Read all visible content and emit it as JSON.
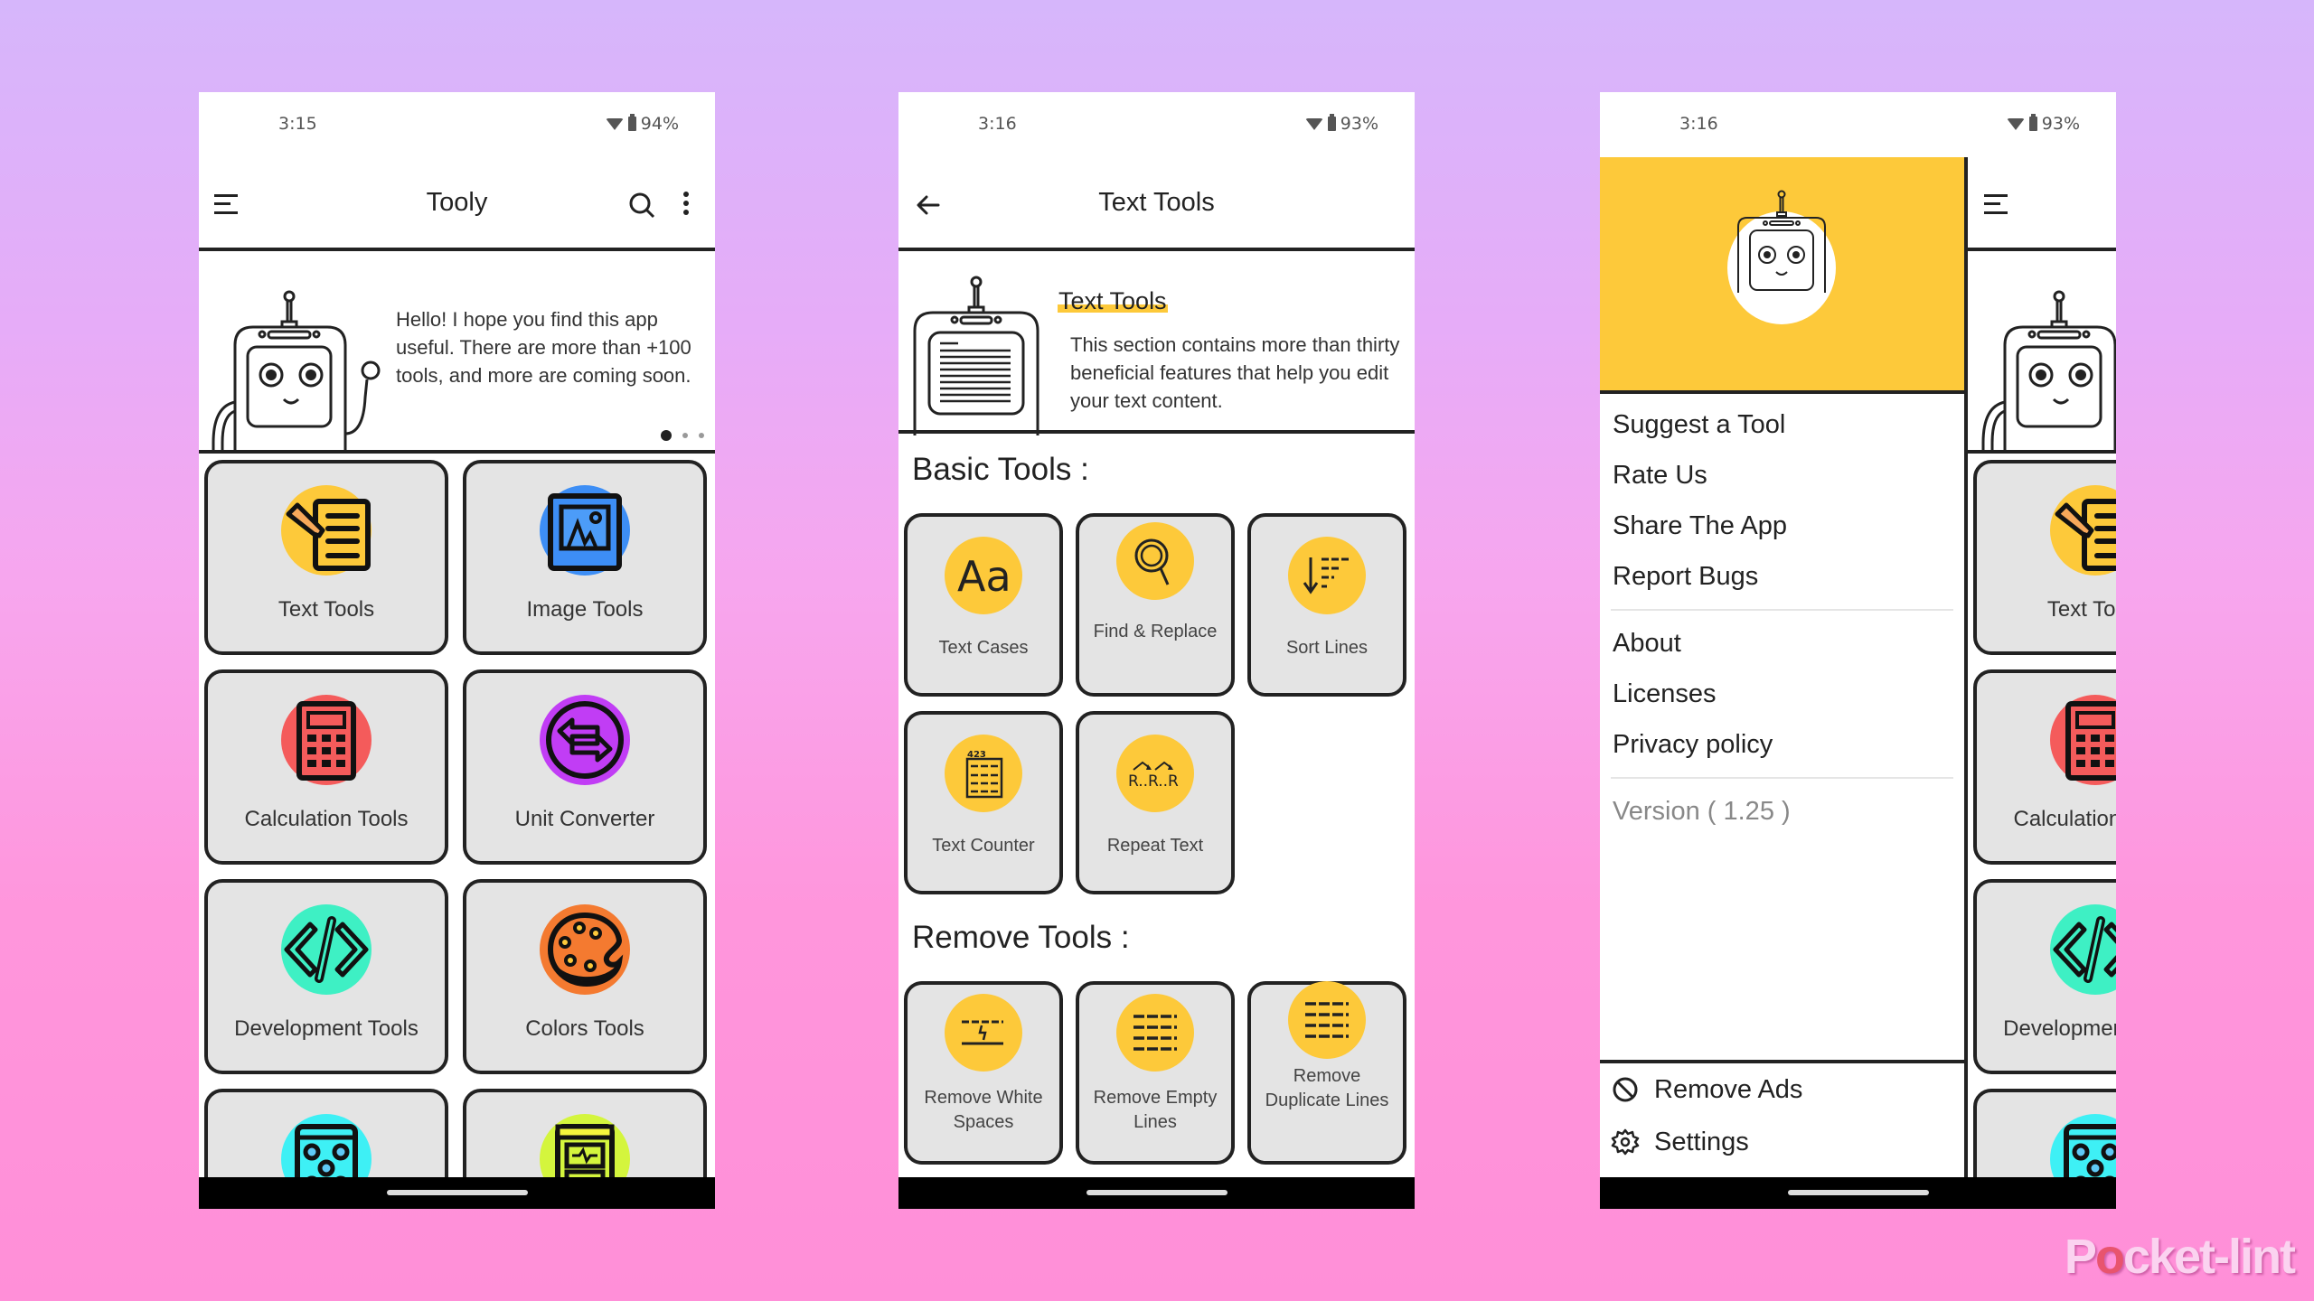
{
  "watermark": {
    "pre": "P",
    "o": "o",
    "post": "cket-lint"
  },
  "phones": [
    {
      "status": {
        "time": "3:15",
        "battery": "94%"
      },
      "appbar": {
        "title": "Tooly",
        "menu_icon": "hamburger-icon",
        "search_icon": "search-icon",
        "more_icon": "more-vert-icon"
      },
      "hero": {
        "text": "Hello! I hope you find this app useful. There are more than +100 tools, and more are coming soon.",
        "carousel_pages": 3,
        "carousel_active": 1
      },
      "categories": [
        {
          "label": "Text Tools",
          "icon": "notes-pencil-icon",
          "color": "#fdc93a"
        },
        {
          "label": "Image Tools",
          "icon": "image-frame-icon",
          "color": "#3d8ef5"
        },
        {
          "label": "Calculation Tools",
          "icon": "calculator-icon",
          "color": "#f45b5b"
        },
        {
          "label": "Unit Converter",
          "icon": "swap-arrows-icon",
          "color": "#c13df5"
        },
        {
          "label": "Development Tools",
          "icon": "code-icon",
          "color": "#3ef0c4"
        },
        {
          "label": "Colors Tools",
          "icon": "palette-icon",
          "color": "#f47a30"
        },
        {
          "label": "",
          "icon": "dice-icon",
          "color": "#3ef0f5"
        },
        {
          "label": "",
          "icon": "cabinet-icon",
          "color": "#d4f53d"
        }
      ]
    },
    {
      "status": {
        "time": "3:16",
        "battery": "93%"
      },
      "appbar": {
        "title": "Text Tools",
        "back_icon": "arrow-back-icon"
      },
      "hero": {
        "title": "Text Tools",
        "text": "This section contains more than thirty beneficial features that help you edit your text content."
      },
      "sections": [
        {
          "title": "Basic Tools :",
          "tools": [
            {
              "label": "Text Cases",
              "icon": "text-case-icon"
            },
            {
              "label": "Find & Replace",
              "icon": "find-replace-icon"
            },
            {
              "label": "Sort Lines",
              "icon": "sort-lines-icon"
            },
            {
              "label": "Text Counter",
              "icon": "text-counter-icon"
            },
            {
              "label": "Repeat Text",
              "icon": "repeat-text-icon"
            }
          ]
        },
        {
          "title": "Remove Tools :",
          "tools": [
            {
              "label": "Remove White Spaces",
              "icon": "remove-spaces-icon"
            },
            {
              "label": "Remove Empty Lines",
              "icon": "remove-empty-lines-icon"
            },
            {
              "label": "Remove Duplicate Lines",
              "icon": "remove-duplicate-lines-icon"
            }
          ]
        }
      ],
      "accent": "#fdc93a"
    },
    {
      "status": {
        "time": "3:16",
        "battery": "93%"
      },
      "drawer": {
        "menu_group_1": [
          "Suggest a Tool",
          "Rate Us",
          "Share The App",
          "Report Bugs"
        ],
        "menu_group_2": [
          "About",
          "Licenses",
          "Privacy policy"
        ],
        "version": "Version ( 1.25 )",
        "footer": [
          {
            "label": "Remove Ads",
            "icon": "block-icon"
          },
          {
            "label": "Settings",
            "icon": "gear-icon"
          }
        ],
        "header_color": "#fdc93a"
      },
      "behind": {
        "tiles": [
          "Text Tools",
          "Calculation Tools",
          "Development Tools"
        ]
      }
    }
  ]
}
